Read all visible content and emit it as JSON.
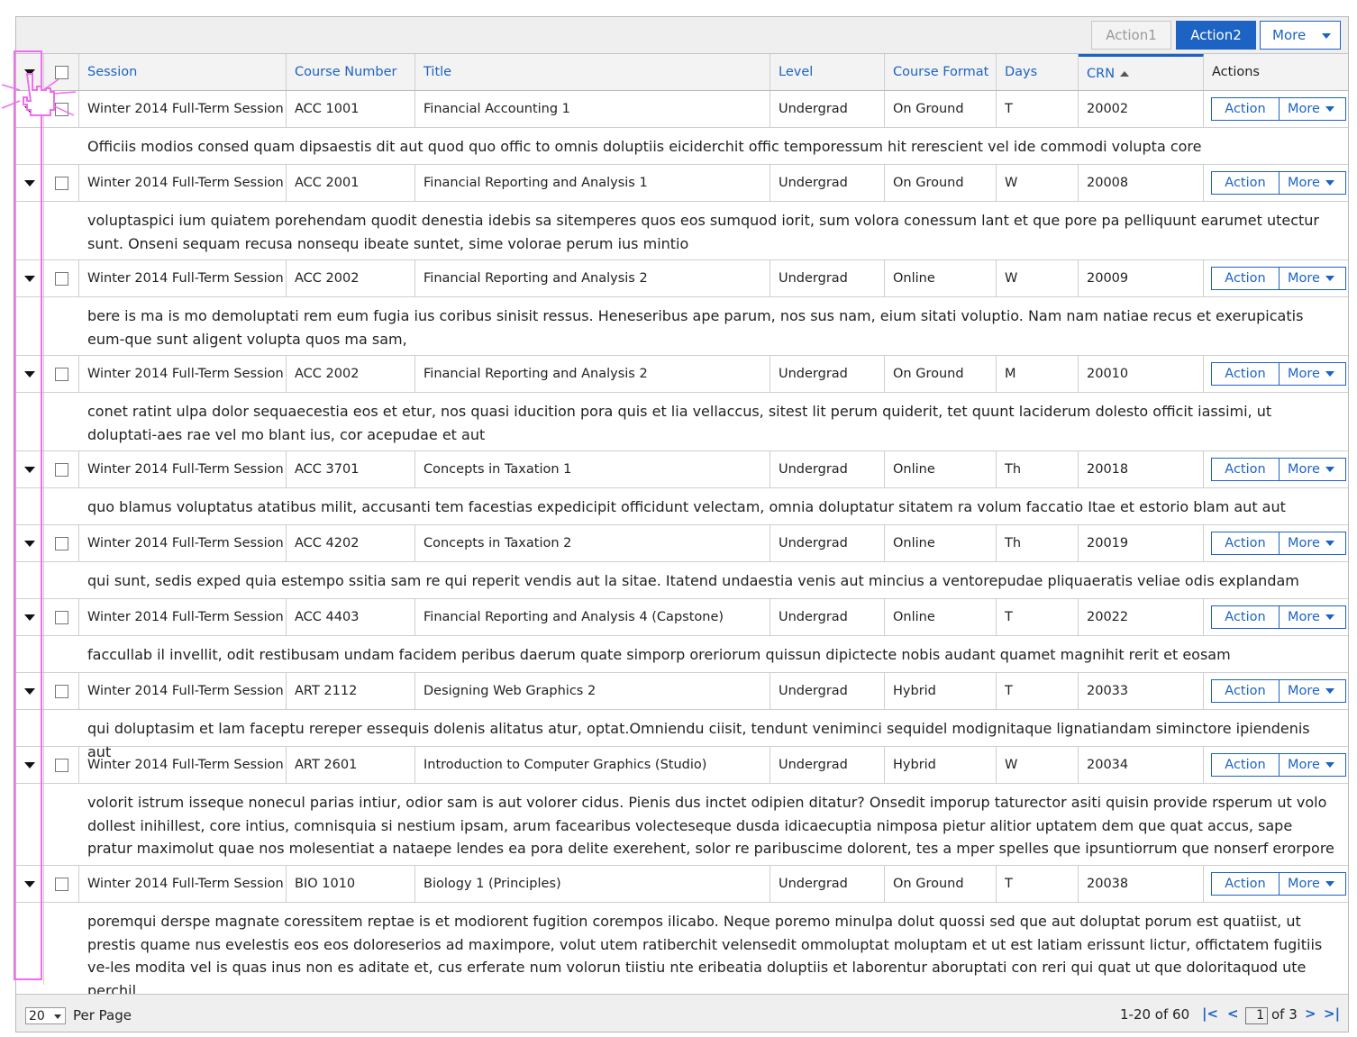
{
  "toolbar": {
    "action1": "Action1",
    "action2": "Action2",
    "more": "More"
  },
  "columns": {
    "session": "Session",
    "course_number": "Course Number",
    "title": "Title",
    "level": "Level",
    "course_format": "Course Format",
    "days": "Days",
    "crn": "CRN",
    "actions": "Actions"
  },
  "row_buttons": {
    "action": "Action",
    "more": "More"
  },
  "rows": [
    {
      "session": "Winter 2014 Full-Term Session",
      "course_number": "ACC 1001",
      "title": "Financial Accounting 1",
      "level": "Undergrad",
      "format": "On Ground",
      "days": "T",
      "crn": "20002",
      "description": "Officiis modios consed quam dipsaestis dit aut quod quo offic to omnis doluptiis eiciderchit offic temporessum hit rerescient vel ide commodi volupta core"
    },
    {
      "session": "Winter 2014 Full-Term Session",
      "course_number": "ACC 2001",
      "title": "Financial Reporting and Analysis 1",
      "level": "Undergrad",
      "format": "On Ground",
      "days": "W",
      "crn": "20008",
      "description": "voluptaspici ium quiatem porehendam quodit denestia idebis sa sitemperes quos eos sumquod iorit, sum volora conessum lant et que pore pa pelliquunt earumet utectur sunt. Onseni sequam recusa nonsequ ibeate suntet, sime volorae perum ius mintio"
    },
    {
      "session": "Winter 2014 Full-Term Session",
      "course_number": "ACC 2002",
      "title": "Financial Reporting and Analysis 2",
      "level": "Undergrad",
      "format": "Online",
      "days": "W",
      "crn": "20009",
      "description": "bere is ma is mo demoluptati rem eum fugia ius coribus sinisit ressus. Heneseribus ape parum, nos sus nam, eium sitati voluptio. Nam nam natiae recus et exerupicatis eum-que sunt aligent volupta quos ma sam,"
    },
    {
      "session": "Winter 2014 Full-Term Session",
      "course_number": "ACC 2002",
      "title": "Financial Reporting and Analysis 2",
      "level": "Undergrad",
      "format": "On Ground",
      "days": "M",
      "crn": "20010",
      "description": "conet ratint ulpa dolor sequaecestia eos et etur, nos quasi iducition pora quis et lia vellaccus, sitest lit perum quiderit, tet quunt laciderum dolesto officit iassimi, ut doluptati-aes rae vel mo blant ius, cor acepudae et aut"
    },
    {
      "session": "Winter 2014 Full-Term Session",
      "course_number": "ACC 3701",
      "title": "Concepts in Taxation 1",
      "level": "Undergrad",
      "format": "Online",
      "days": "Th",
      "crn": "20018",
      "description": "quo blamus voluptatus atatibus milit, accusanti tem facestias expedicipit officidunt velectam, omnia doluptatur sitatem ra volum faccatio Itae et estorio blam aut aut"
    },
    {
      "session": "Winter 2014 Full-Term Session",
      "course_number": "ACC 4202",
      "title": "Concepts in Taxation 2",
      "level": "Undergrad",
      "format": "Online",
      "days": "Th",
      "crn": "20019",
      "description": "qui sunt, sedis exped quia estempo ssitia sam re qui reperit vendis aut la sitae. Itatend undaestia venis aut mincius a ventorepudae pliquaeratis veliae odis explandam"
    },
    {
      "session": "Winter 2014 Full-Term Session",
      "course_number": "ACC 4403",
      "title": "Financial Reporting and Analysis 4 (Capstone)",
      "level": "Undergrad",
      "format": "Online",
      "days": "T",
      "crn": "20022",
      "description": "faccullab il invellit, odit restibusam undam facidem peribus daerum quate simporp oreriorum quissun dipictecte nobis audant quamet magnihit rerit et eosam"
    },
    {
      "session": "Winter 2014 Full-Term Session",
      "course_number": "ART 2112",
      "title": "Designing Web Graphics 2",
      "level": "Undergrad",
      "format": "Hybrid",
      "days": "T",
      "crn": "20033",
      "description": "qui doluptasim et lam faceptu rereper essequis dolenis alitatus atur, optat.Omniendu ciisit, tendunt veniminci sequidel modignitaque lignatiandam siminctore ipiendenis aut"
    },
    {
      "session": "Winter 2014 Full-Term Session",
      "course_number": "ART 2601",
      "title": "Introduction to Computer Graphics (Studio)",
      "level": "Undergrad",
      "format": "Hybrid",
      "days": "W",
      "crn": "20034",
      "description": "volorit istrum isseque nonecul parias intiur, odior sam is aut volorer cidus. Pienis dus inctet odipien ditatur? Onsedit imporup taturector asiti quisin provide rsperum ut volo dollest inihillest, core intius, comnisquia si nestium ipsam, arum facearibus volecteseque dusda idicaecuptia nimposa pietur alitior uptatem dem que quat accus, sape pratur maximolut quae nos molesentiat a nataepe lendes ea pora delite exerehent, solor re paribuscime dolorent, tes a mper spelles que ipsuntiorrum que nonserf erorpore"
    },
    {
      "session": "Winter 2014 Full-Term Session",
      "course_number": "BIO 1010",
      "title": "Biology 1 (Principles)",
      "level": "Undergrad",
      "format": "On Ground",
      "days": "T",
      "crn": "20038",
      "description": "poremqui derspe magnate coressitem reptae is et modiorent fugition corempos ilicabo. Neque poremo minulpa dolut quossi sed que aut doluptat porum est quatiist, ut prestis quame nus evelestis eos eos doloreserios ad maximpore, volut utem ratiberchit velensedit ommoluptat moluptam et ut est latiam erissunt lictur, offictatem fugitiis ve-les modita vel is quas inus non es aditate et, cus erferate num volorun tiistiu nte eribeatia doluptiis et laborentur aboruptati con reri qui quat ut que doloritaquod ute perchil"
    }
  ],
  "pagination": {
    "per_page_value": "20",
    "per_page_label": "Per Page",
    "range": "1-20 of 60",
    "first": "|<",
    "prev": "<",
    "page": "1",
    "of_pages": "of 3",
    "next": ">",
    "last": ">|"
  },
  "colors": {
    "accent": "#1d63c3",
    "annotation": "#ef6ef0",
    "wave": "#e8161b"
  }
}
